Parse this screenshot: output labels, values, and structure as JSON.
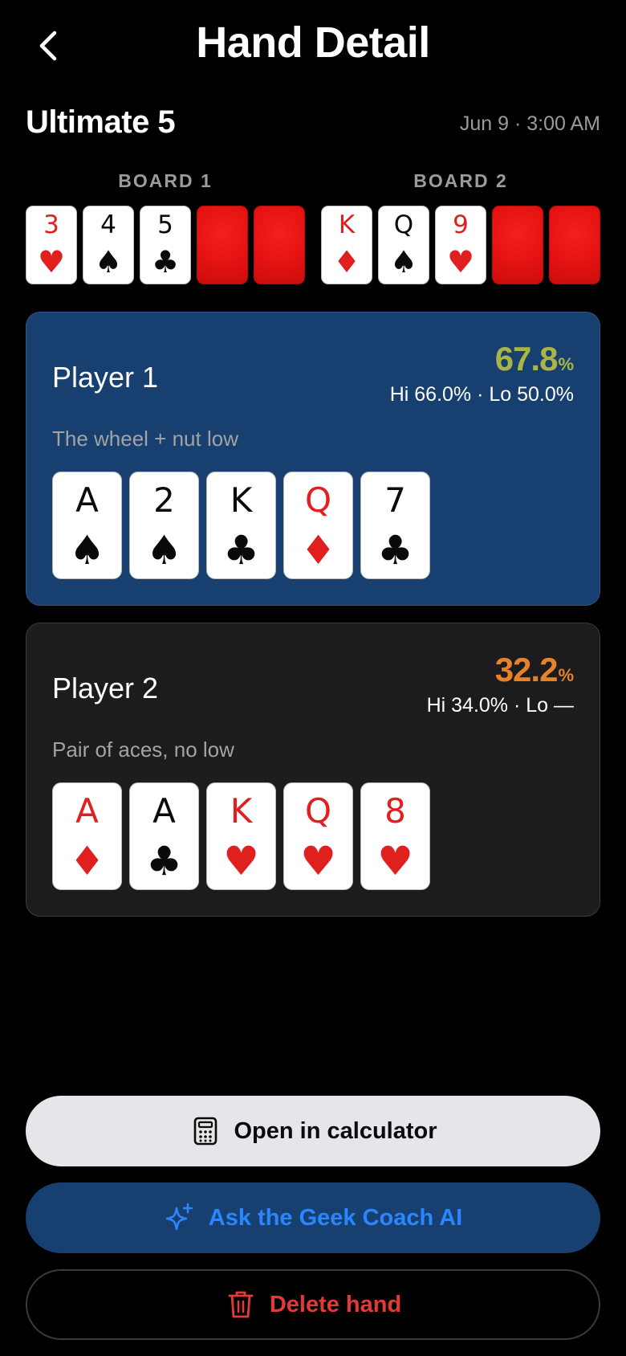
{
  "header": {
    "title": "Hand Detail",
    "back_icon": "chevron-left-icon"
  },
  "game": {
    "name": "Ultimate 5",
    "date": "Jun 9 · 3:00 AM"
  },
  "boards": [
    {
      "label": "BOARD 1",
      "cards": [
        {
          "rank": "3",
          "suit": "♥",
          "color": "red"
        },
        {
          "rank": "4",
          "suit": "♠",
          "color": "black"
        },
        {
          "rank": "5",
          "suit": "♣",
          "color": "black"
        },
        {
          "face_down": true
        },
        {
          "face_down": true
        }
      ]
    },
    {
      "label": "BOARD 2",
      "cards": [
        {
          "rank": "K",
          "suit": "♦",
          "color": "red"
        },
        {
          "rank": "Q",
          "suit": "♠",
          "color": "black"
        },
        {
          "rank": "9",
          "suit": "♥",
          "color": "red"
        },
        {
          "face_down": true
        },
        {
          "face_down": true
        }
      ]
    }
  ],
  "players": [
    {
      "name": "Player 1",
      "equity": "67.8",
      "equity_unit": "%",
      "equity_color": "#a9b545",
      "hi_lo": "Hi 66.0% · Lo 50.0%",
      "description": "The wheel + nut low",
      "cards": [
        {
          "rank": "A",
          "suit": "♠",
          "color": "black"
        },
        {
          "rank": "2",
          "suit": "♠",
          "color": "black"
        },
        {
          "rank": "K",
          "suit": "♣",
          "color": "black"
        },
        {
          "rank": "Q",
          "suit": "♦",
          "color": "red"
        },
        {
          "rank": "7",
          "suit": "♣",
          "color": "black"
        }
      ]
    },
    {
      "name": "Player 2",
      "equity": "32.2",
      "equity_unit": "%",
      "equity_color": "#e8822a",
      "hi_lo": "Hi 34.0% · Lo —",
      "description": "Pair of aces, no low",
      "cards": [
        {
          "rank": "A",
          "suit": "♦",
          "color": "red"
        },
        {
          "rank": "A",
          "suit": "♣",
          "color": "black"
        },
        {
          "rank": "K",
          "suit": "♥",
          "color": "red"
        },
        {
          "rank": "Q",
          "suit": "♥",
          "color": "red"
        },
        {
          "rank": "8",
          "suit": "♥",
          "color": "red"
        }
      ]
    }
  ],
  "actions": {
    "calculator_label": "Open in calculator",
    "calculator_icon": "calculator-icon",
    "coach_label": "Ask the Geek Coach AI",
    "coach_icon": "sparkles-icon",
    "delete_label": "Delete hand",
    "delete_icon": "trash-icon"
  },
  "colors": {
    "background": "#000000",
    "player1_panel": "#173f6f",
    "player2_panel": "#1c1c1e",
    "red_suit": "#e0201f",
    "coach_text": "#2a86ff",
    "delete_text": "#e23a36"
  }
}
